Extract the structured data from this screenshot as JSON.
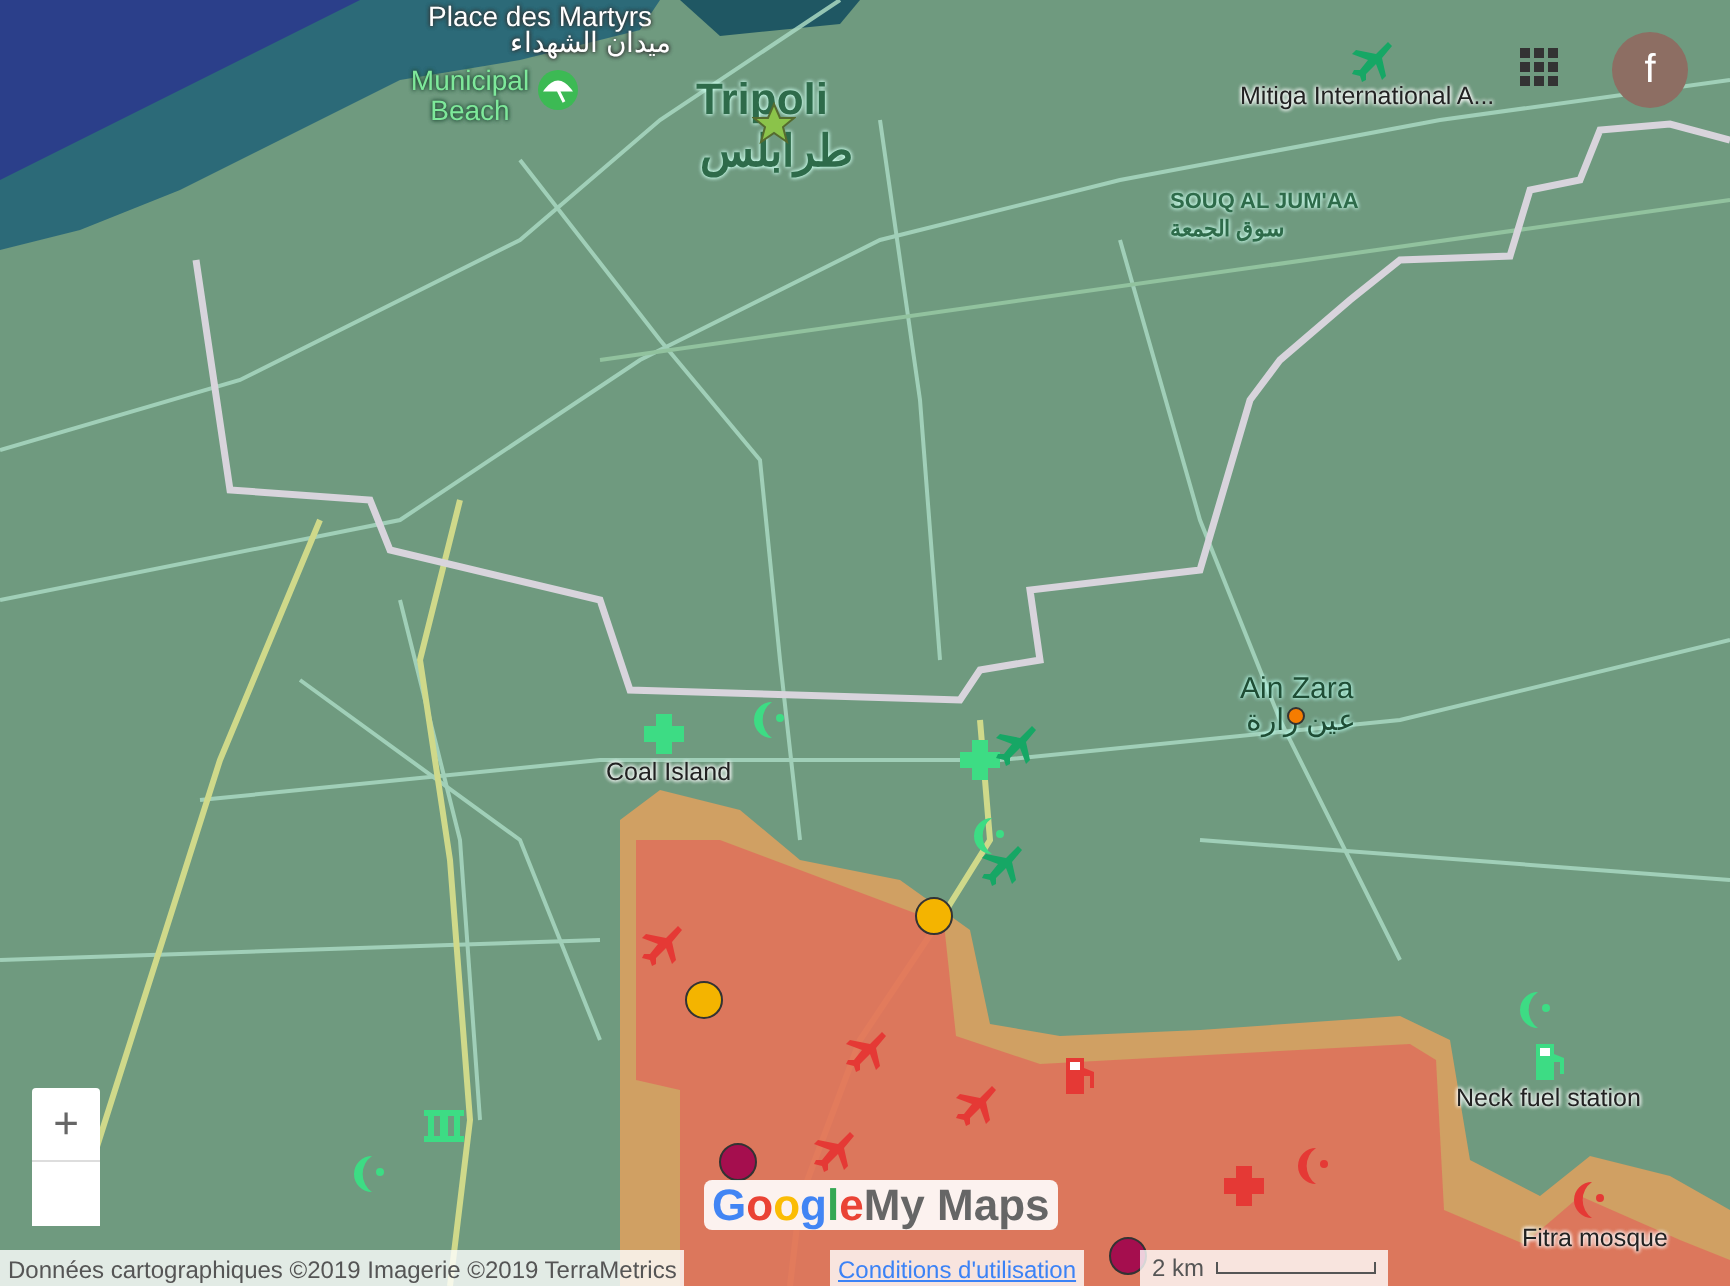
{
  "labels": [
    {
      "kind": "plaza",
      "text": "Place des Martyrs"
    },
    {
      "kind": "plaza",
      "text": "ميدان الشهداء"
    },
    {
      "kind": "beach",
      "text": "Municipal Beach"
    },
    {
      "kind": "city",
      "text": "Tripoli"
    },
    {
      "kind": "city",
      "text": "طرابلس"
    },
    {
      "kind": "district",
      "text": "SOUQ AL JUM'AA"
    },
    {
      "kind": "district",
      "text": "سوق الجمعة"
    },
    {
      "kind": "poi",
      "text": "Mitiga International A..."
    },
    {
      "kind": "town",
      "text": "Ain Zara"
    },
    {
      "kind": "town",
      "text": "عين زارة"
    },
    {
      "kind": "poi",
      "text": "Coal Island"
    },
    {
      "kind": "poi",
      "text": "Neck fuel station"
    },
    {
      "kind": "poi",
      "text": "Fitra mosque"
    }
  ],
  "markers": [
    {
      "kind": "star",
      "color": "#8bc34a"
    },
    {
      "kind": "beach",
      "color": "#3cba54"
    },
    {
      "kind": "plane",
      "color": "#16a765"
    },
    {
      "kind": "dot",
      "color": "#f57c00"
    },
    {
      "kind": "cross",
      "color": "#3ddc84"
    },
    {
      "kind": "crescent",
      "color": "#3ddc84"
    },
    {
      "kind": "cross",
      "color": "#3ddc84"
    },
    {
      "kind": "plane",
      "color": "#16a765"
    },
    {
      "kind": "crescent",
      "color": "#3ddc84"
    },
    {
      "kind": "plane",
      "color": "#16a765"
    },
    {
      "kind": "dot",
      "color": "#f4b400"
    },
    {
      "kind": "dot",
      "color": "#f4b400"
    },
    {
      "kind": "plane",
      "color": "#e53935"
    },
    {
      "kind": "plane",
      "color": "#e53935"
    },
    {
      "kind": "plane",
      "color": "#e53935"
    },
    {
      "kind": "plane",
      "color": "#e53935"
    },
    {
      "kind": "fuel",
      "color": "#e53935"
    },
    {
      "kind": "dot",
      "color": "#a50e4e"
    },
    {
      "kind": "dot",
      "color": "#a50e4e"
    },
    {
      "kind": "cross",
      "color": "#e53935"
    },
    {
      "kind": "crescent",
      "color": "#e53935"
    },
    {
      "kind": "crescent",
      "color": "#e53935"
    },
    {
      "kind": "crescent",
      "color": "#3ddc84"
    },
    {
      "kind": "fuel",
      "color": "#3ddc84"
    },
    {
      "kind": "crescent",
      "color": "#3ddc84"
    },
    {
      "kind": "building",
      "color": "#3ddc84"
    }
  ],
  "account": {
    "initial": "f"
  },
  "zoom": {
    "plus": "+"
  },
  "logo": {
    "brand": "Google",
    "product": "My Maps"
  },
  "footer": {
    "attribution": "Données cartographiques ©2019 Imagerie ©2019 TerraMetrics",
    "terms_link": "Conditions d'utilisation",
    "scale": "2 km"
  }
}
